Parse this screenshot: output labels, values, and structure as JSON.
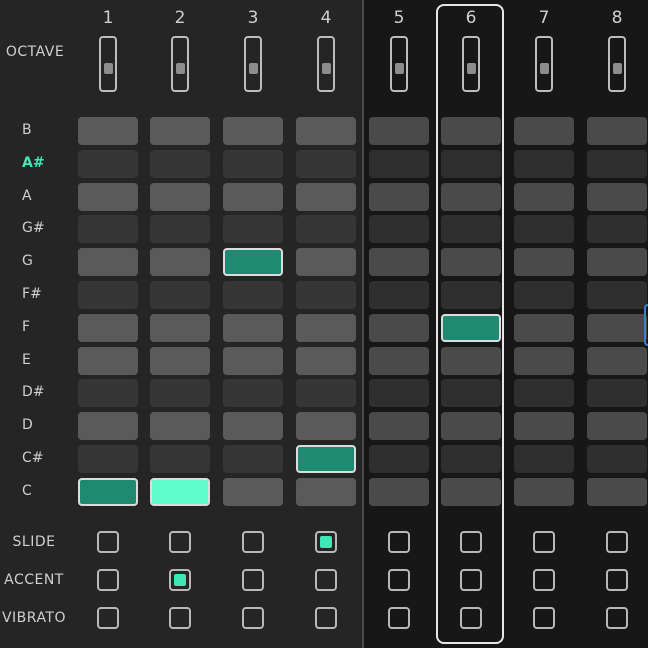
{
  "columns": [
    "1",
    "2",
    "3",
    "4",
    "5",
    "6",
    "7",
    "8"
  ],
  "octave_label": "OCTAVE",
  "notes": [
    {
      "label": "B",
      "type": "natural"
    },
    {
      "label": "A#",
      "type": "sharp",
      "highlighted": true
    },
    {
      "label": "A",
      "type": "natural"
    },
    {
      "label": "G#",
      "type": "sharp"
    },
    {
      "label": "G",
      "type": "natural"
    },
    {
      "label": "F#",
      "type": "sharp"
    },
    {
      "label": "F",
      "type": "natural"
    },
    {
      "label": "E",
      "type": "natural"
    },
    {
      "label": "D#",
      "type": "sharp"
    },
    {
      "label": "D",
      "type": "natural"
    },
    {
      "label": "C#",
      "type": "sharp"
    },
    {
      "label": "C",
      "type": "natural"
    }
  ],
  "active_notes": [
    {
      "step": 1,
      "note": "C",
      "style": "dark"
    },
    {
      "step": 2,
      "note": "C",
      "style": "bright"
    },
    {
      "step": 3,
      "note": "G",
      "style": "dark"
    },
    {
      "step": 4,
      "note": "C#",
      "style": "dark"
    },
    {
      "step": 6,
      "note": "F",
      "style": "dark"
    }
  ],
  "current_step": 6,
  "modifiers": [
    {
      "label": "SLIDE",
      "values": [
        false,
        false,
        false,
        true,
        false,
        false,
        false,
        false
      ]
    },
    {
      "label": "ACCENT",
      "values": [
        false,
        true,
        false,
        false,
        false,
        false,
        false,
        false
      ]
    },
    {
      "label": "VIBRATO",
      "values": [
        false,
        false,
        false,
        false,
        false,
        false,
        false,
        false
      ]
    }
  ],
  "colors": {
    "accent": "#3ee8b4",
    "active_cell": "#1f8a72",
    "active_bright": "#5dfcc8"
  }
}
